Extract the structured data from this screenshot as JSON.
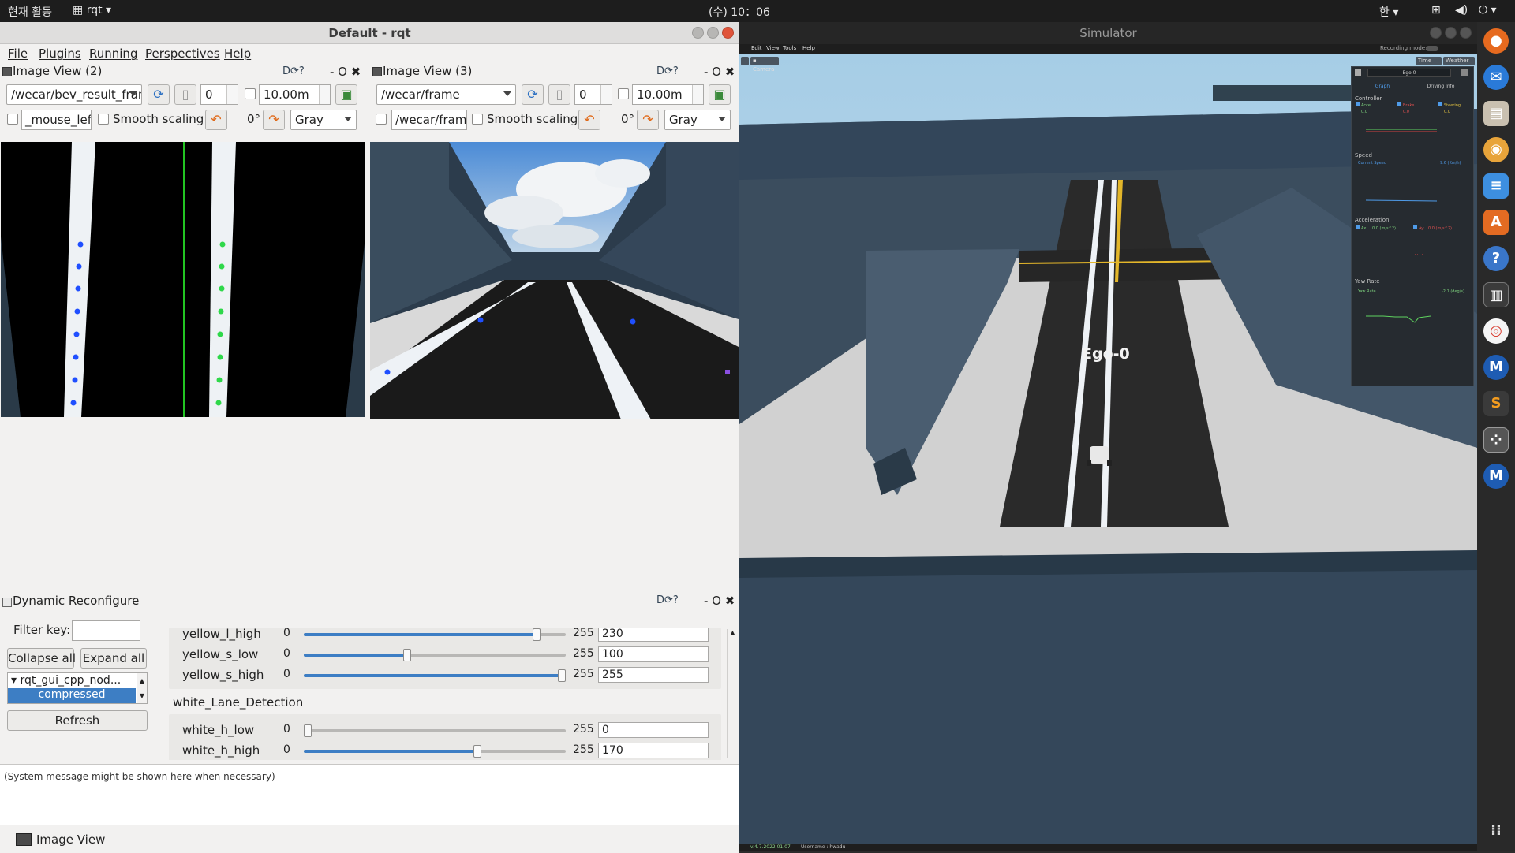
{
  "topbar": {
    "activities": "현재 활동",
    "app_menu": "rqt",
    "clock": "(수) 10：06",
    "lang": "한"
  },
  "rqt": {
    "title": "Default - rqt",
    "menu": [
      "File",
      "Plugins",
      "Running",
      "Perspectives",
      "Help"
    ],
    "image_view_left": {
      "title": "Image View (2)",
      "topic": "/wecar/bev_result_frame",
      "spin_value": "0",
      "max_range": "10.00m",
      "mouse_topic": "_mouse_left",
      "smooth_label": "Smooth scaling",
      "rotation": "0°",
      "color_scheme": "Gray"
    },
    "image_view_right": {
      "title": "Image View (3)",
      "topic": "/wecar/frame",
      "spin_value": "0",
      "max_range": "10.00m",
      "mouse_topic": "/wecar/frame",
      "smooth_label": "Smooth scaling",
      "rotation": "0°",
      "color_scheme": "Gray"
    },
    "titlebar_icons": "D⟳?",
    "dock_controls": "- O ✖",
    "dynamic_reconfigure": {
      "title": "Dynamic Reconfigure",
      "filter_label": "Filter key:",
      "filter_value": "",
      "collapse_label": "Collapse all",
      "expand_label": "Expand all",
      "tree_node": "rqt_gui_cpp_nod...",
      "tree_selected": "compressed",
      "refresh_label": "Refresh",
      "group_label": "white_Lane_Detection",
      "params": [
        {
          "name": "yellow_l_high",
          "min": "0",
          "max": "255",
          "value": "230",
          "fraction": 0.902
        },
        {
          "name": "yellow_s_low",
          "min": "0",
          "max": "255",
          "value": "100",
          "fraction": 0.392
        },
        {
          "name": "yellow_s_high",
          "min": "0",
          "max": "255",
          "value": "255",
          "fraction": 1.0
        },
        {
          "name": "white_h_low",
          "min": "0",
          "max": "255",
          "value": "0",
          "fraction": 0.0
        },
        {
          "name": "white_h_high",
          "min": "0",
          "max": "255",
          "value": "170",
          "fraction": 0.667
        }
      ]
    },
    "system_message": "(System message might be shown here when necessary)",
    "status_item": "Image View"
  },
  "simulator": {
    "title": "Simulator",
    "menu": [
      "Edit",
      "View",
      "Tools",
      "Help"
    ],
    "recording_label": "Recording mode:",
    "camera_label": "Camera",
    "time_label": "Time",
    "weather_label": "Weather",
    "vehicle_label": "Ego-0",
    "panel": {
      "vehicle_select": "Ego 0",
      "tabs": [
        "Graph",
        "Driving Info"
      ],
      "sections": [
        "Controller",
        "Speed",
        "Acceleration",
        "Yaw Rate"
      ],
      "controller_items": [
        "Accel",
        "Brake",
        "Steering"
      ],
      "controller_values": [
        "0.0",
        "0.0",
        "0.0"
      ],
      "speed_label": "Current Speed",
      "speed_value": "9.6  (Km/h)",
      "accel_items": [
        "Ax:",
        "Ay:"
      ],
      "accel_values": [
        "0.0 (m/s^2)",
        "0.0 (m/s^2)"
      ],
      "yaw_label": "Yaw Rate",
      "yaw_value": "-2.1  (deg/s)"
    },
    "status_version": "v.4.7.2022.01.07",
    "status_user": "Username : hwadu"
  },
  "dock_icons": [
    "firefox-icon",
    "thunderbird-icon",
    "files-icon",
    "rhythmbox-icon",
    "writer-icon",
    "software-icon",
    "help-icon",
    "terminal-icon",
    "chrome-icon",
    "m-app-icon",
    "sublime-icon",
    "settings-grid-icon",
    "m-app-icon-2"
  ],
  "colors": {
    "selection": "#3d7ec4",
    "lane_blue": "#1f4fff",
    "lane_green": "#2fd84a",
    "wall": "#3b4d5e"
  }
}
